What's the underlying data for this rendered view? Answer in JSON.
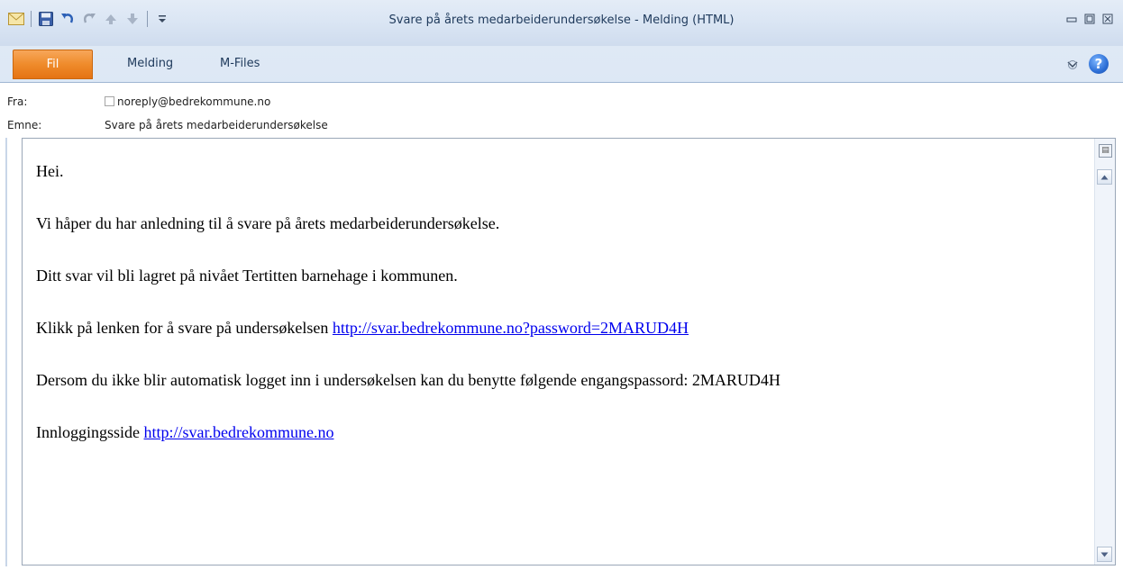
{
  "window": {
    "title": "Svare på årets medarbeiderundersøkelse  -  Melding (HTML)"
  },
  "quick_access": [
    "envelope-icon",
    "save-icon",
    "undo-icon",
    "redo-icon",
    "previous-item-icon",
    "next-item-icon",
    "customize-toolbar-icon"
  ],
  "ribbon": {
    "tabs": {
      "file": "Fil",
      "message": "Melding",
      "mfiles": "M-Files"
    }
  },
  "header": {
    "from_label": "Fra:",
    "from_value": "noreply@bedrekommune.no",
    "subject_label": "Emne:",
    "subject_value": "Svare på årets medarbeiderundersøkelse"
  },
  "body": {
    "greeting": "Hei.",
    "line1": "Vi håper du har anledning til å svare på årets medarbeiderundersøkelse.",
    "line2": "Ditt svar vil bli lagret på nivået Tertitten barnehage i kommunen.",
    "line3_text": "Klikk på lenken for å svare på undersøkelsen ",
    "line3_link": "http://svar.bedrekommune.no?password=2MARUD4H",
    "line4": "Dersom du ikke blir automatisk logget inn i undersøkelsen kan du benytte følgende engangspassord: 2MARUD4H",
    "line5_text": "Innloggingsside ",
    "line5_link": "http://svar.bedrekommune.no"
  },
  "colors": {
    "file_tab": "#ef8b2b",
    "link": "#0000ee",
    "title_text": "#1e395b"
  }
}
